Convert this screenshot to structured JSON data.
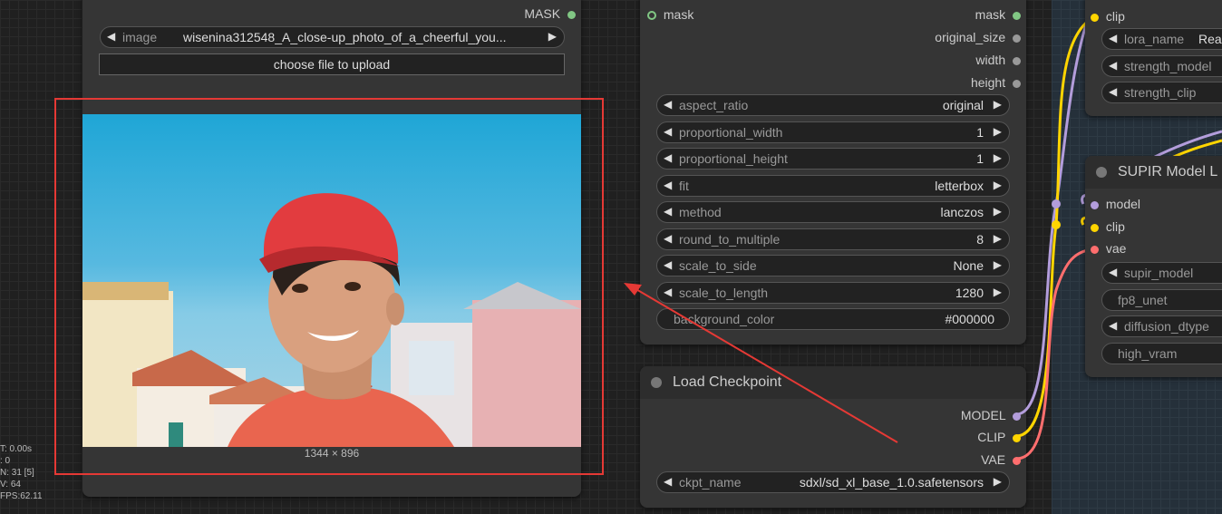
{
  "load_image_node": {
    "output_mask_label": "MASK",
    "image_widget": {
      "name": "image",
      "value": "wisenina312548_A_close-up_photo_of_a_cheerful_you..."
    },
    "upload_button_label": "choose file to upload",
    "image_size_label": "1344 × 896",
    "photo_description": "close-up photo of a cheerful young man in a red cap and red t-shirt against blue sky and white houses"
  },
  "image_resize_node": {
    "input_mask_label": "mask",
    "outputs": [
      "mask",
      "original_size",
      "width",
      "height"
    ],
    "widgets": [
      {
        "name": "aspect_ratio",
        "value": "original"
      },
      {
        "name": "proportional_width",
        "value": "1"
      },
      {
        "name": "proportional_height",
        "value": "1"
      },
      {
        "name": "fit",
        "value": "letterbox"
      },
      {
        "name": "method",
        "value": "lanczos"
      },
      {
        "name": "round_to_multiple",
        "value": "8"
      },
      {
        "name": "scale_to_side",
        "value": "None"
      },
      {
        "name": "scale_to_length",
        "value": "1280"
      },
      {
        "name": "background_color",
        "value": "#000000"
      }
    ]
  },
  "load_checkpoint_node": {
    "title": "Load Checkpoint",
    "outputs": [
      "MODEL",
      "CLIP",
      "VAE"
    ],
    "ckpt_widget": {
      "name": "ckpt_name",
      "value": "sdxl/sd_xl_base_1.0.safetensors"
    }
  },
  "lora_node": {
    "input_clip_label": "clip",
    "widgets": [
      {
        "name": "lora_name",
        "value": "Real"
      },
      {
        "name": "strength_model",
        "value": ""
      },
      {
        "name": "strength_clip",
        "value": ""
      }
    ]
  },
  "supir_node": {
    "title": "SUPIR Model L",
    "inputs": [
      "model",
      "clip",
      "vae"
    ],
    "widgets": [
      {
        "name": "supir_model",
        "value": ""
      },
      {
        "name": "fp8_unet",
        "value": ""
      },
      {
        "name": "diffusion_dtype",
        "value": ""
      },
      {
        "name": "high_vram",
        "value": ""
      }
    ]
  },
  "stats": [
    "T: 0.00s",
    ": 0",
    "N: 31 [5]",
    "V: 64",
    "FPS:62.11"
  ],
  "colors": {
    "highlight_box": "#e53935",
    "model_wire": "#b39ddb",
    "clip_wire": "#ffd500",
    "vae_wire": "#ff6e6e",
    "mask_dot": "#81c784"
  }
}
